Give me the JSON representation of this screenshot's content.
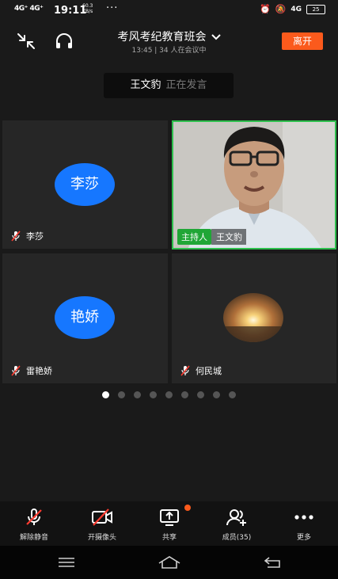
{
  "status_bar": {
    "network": "4G⁺ 4G⁺",
    "time": "19:11",
    "speed_value": "60.3",
    "speed_unit": "KB/s",
    "dots": "···",
    "signal": "4G",
    "battery": "25"
  },
  "header": {
    "title": "考风考纪教育班会",
    "subtitle": "13:45 | 34 人在会议中",
    "leave_label": "离开"
  },
  "speaking": {
    "name": "王文豹",
    "status": "正在发言"
  },
  "tiles": [
    {
      "avatar_text": "李莎",
      "name": "李莎"
    },
    {
      "host_badge": "主持人",
      "name": "王文豹"
    },
    {
      "avatar_text": "艳娇",
      "name": "雷艳娇"
    },
    {
      "name": "何民城"
    }
  ],
  "pager": {
    "pages": 9,
    "current": 1
  },
  "toolbar": {
    "unmute_label": "解除静音",
    "camera_label": "开摄像头",
    "share_label": "共享",
    "members_label": "成员(35)",
    "more_label": "更多"
  },
  "colors": {
    "accent": "#fb5a1c",
    "avatar_blue": "#1677ff",
    "host_green": "#20a636",
    "active_border": "#2ec04d"
  }
}
